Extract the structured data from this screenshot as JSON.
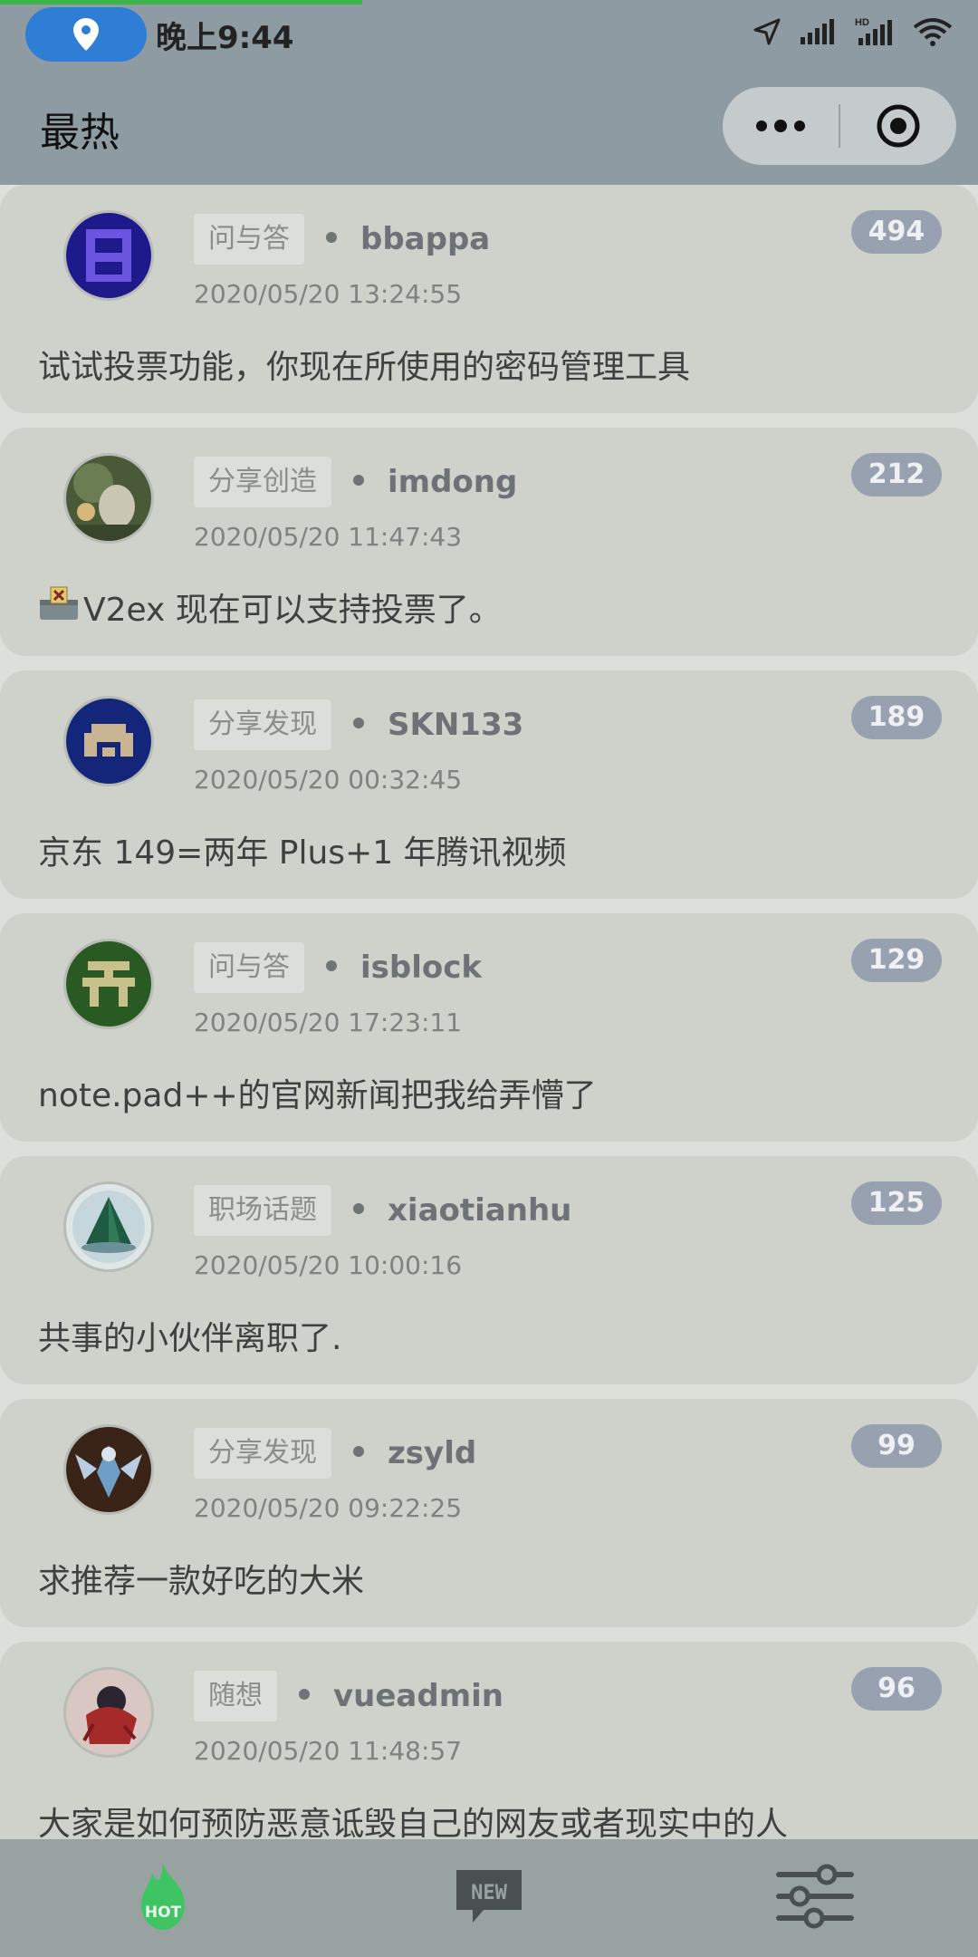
{
  "status_bar": {
    "time": "晚上9:44",
    "icons": [
      "location-pin-icon",
      "navigation-arrow-icon",
      "signal-icon",
      "hd-signal-icon",
      "wifi-icon"
    ]
  },
  "header": {
    "title": "最热",
    "more_button": "more-dots-icon",
    "close_button": "target-icon"
  },
  "topics": [
    {
      "node": "问与答",
      "author": "bbappa",
      "time": "2020/05/20 13:24:55",
      "replies": "494",
      "title": "试试投票功能，你现在所使用的密码管理工具"
    },
    {
      "node": "分享创造",
      "author": "imdong",
      "time": "2020/05/20 11:47:43",
      "replies": "212",
      "title": "V2ex 现在可以支持投票了。",
      "prefix_icon": "ballot-box-icon"
    },
    {
      "node": "分享发现",
      "author": "SKN133",
      "time": "2020/05/20 00:32:45",
      "replies": "189",
      "title": "京东 149=两年 Plus+1 年腾讯视频"
    },
    {
      "node": "问与答",
      "author": "isblock",
      "time": "2020/05/20 17:23:11",
      "replies": "129",
      "title": "note.pad++的官网新闻把我给弄懵了"
    },
    {
      "node": "职场话题",
      "author": "xiaotianhu",
      "time": "2020/05/20 10:00:16",
      "replies": "125",
      "title": "共事的小伙伴离职了."
    },
    {
      "node": "分享发现",
      "author": "zsyld",
      "time": "2020/05/20 09:22:25",
      "replies": "99",
      "title": "求推荐一款好吃的大米"
    },
    {
      "node": "随想",
      "author": "vueadmin",
      "time": "2020/05/20 11:48:57",
      "replies": "96",
      "title": "大家是如何预防恶意诋毁自己的网友或者现实中的人"
    }
  ],
  "tabbar": {
    "tabs": [
      {
        "icon": "hot-flame-icon",
        "label": "HOT",
        "active": true
      },
      {
        "icon": "new-badge-icon",
        "label": "NEW"
      },
      {
        "icon": "settings-sliders-icon"
      }
    ]
  },
  "colors": {
    "accent_green": "#3bb54a",
    "header_bg": "#8e9ba3",
    "count_badge": "#98a1b0"
  }
}
